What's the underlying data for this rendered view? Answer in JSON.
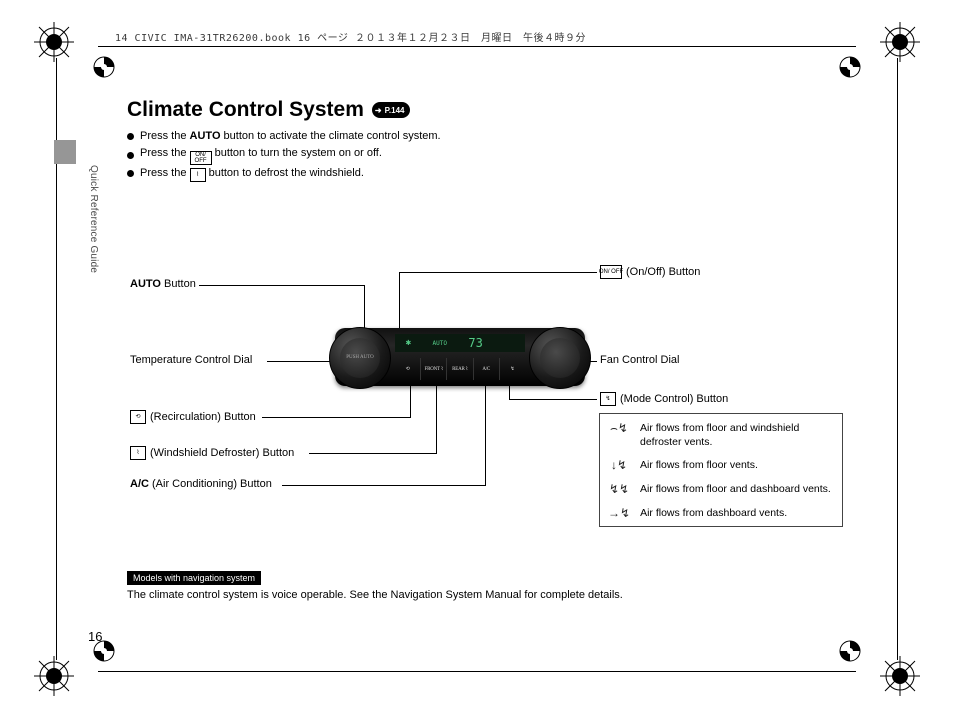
{
  "book_info": "14 CIVIC IMA-31TR26200.book  16 ページ  ２０１３年１２月２３日　月曜日　午後４時９分",
  "sidebar_text": "Quick Reference Guide",
  "page_number": "16",
  "title": "Climate Control System",
  "page_ref": "P.144",
  "bullets": {
    "b1_pre": "Press the ",
    "b1_bold": "AUTO",
    "b1_post": " button to activate the climate control system.",
    "b2_pre": "Press the ",
    "b2_icon": "ON/\nOFF",
    "b2_post": " button to turn the system on or off.",
    "b3_pre": "Press the ",
    "b3_icon": "⌇",
    "b3_post": " button to defrost the windshield."
  },
  "labels": {
    "auto": {
      "bold": "AUTO",
      "rest": " Button"
    },
    "temp": "Temperature Control Dial",
    "recirc": {
      "icon": "⟲",
      "text": " (Recirculation) Button"
    },
    "defrost": {
      "icon": "⌇",
      "text": " (Windshield Defroster) Button"
    },
    "ac": {
      "bold": "A/C",
      "rest": " (Air Conditioning) Button"
    },
    "onoff": {
      "icon": "ON/\nOFF",
      "text": " (On/Off) Button"
    },
    "fan": "Fan Control Dial",
    "mode": {
      "icon": "↯",
      "text": " (Mode Control) Button"
    }
  },
  "unit": {
    "left_dial": "PUSH\nAUTO",
    "display_left": "✱",
    "display_auto": "AUTO",
    "display_temp": "73",
    "btn1": "⟲",
    "btn2": "FRONT\n⌇",
    "btn3": "REAR\n⌇",
    "btn4": "A/C",
    "btn5": "↯"
  },
  "airbox": {
    "r1_icon": "⌢↯",
    "r1_text": "Air flows from floor and windshield defroster vents.",
    "r2_icon": "↓↯",
    "r2_text": "Air flows from floor vents.",
    "r3_icon": "↯↯",
    "r3_text": "Air flows from floor and dashboard vents.",
    "r4_icon": "→↯",
    "r4_text": "Air flows from dashboard vents."
  },
  "footnote": {
    "pill": "Models with navigation system",
    "text": "The climate control system is voice operable. See the Navigation System Manual for complete details."
  }
}
